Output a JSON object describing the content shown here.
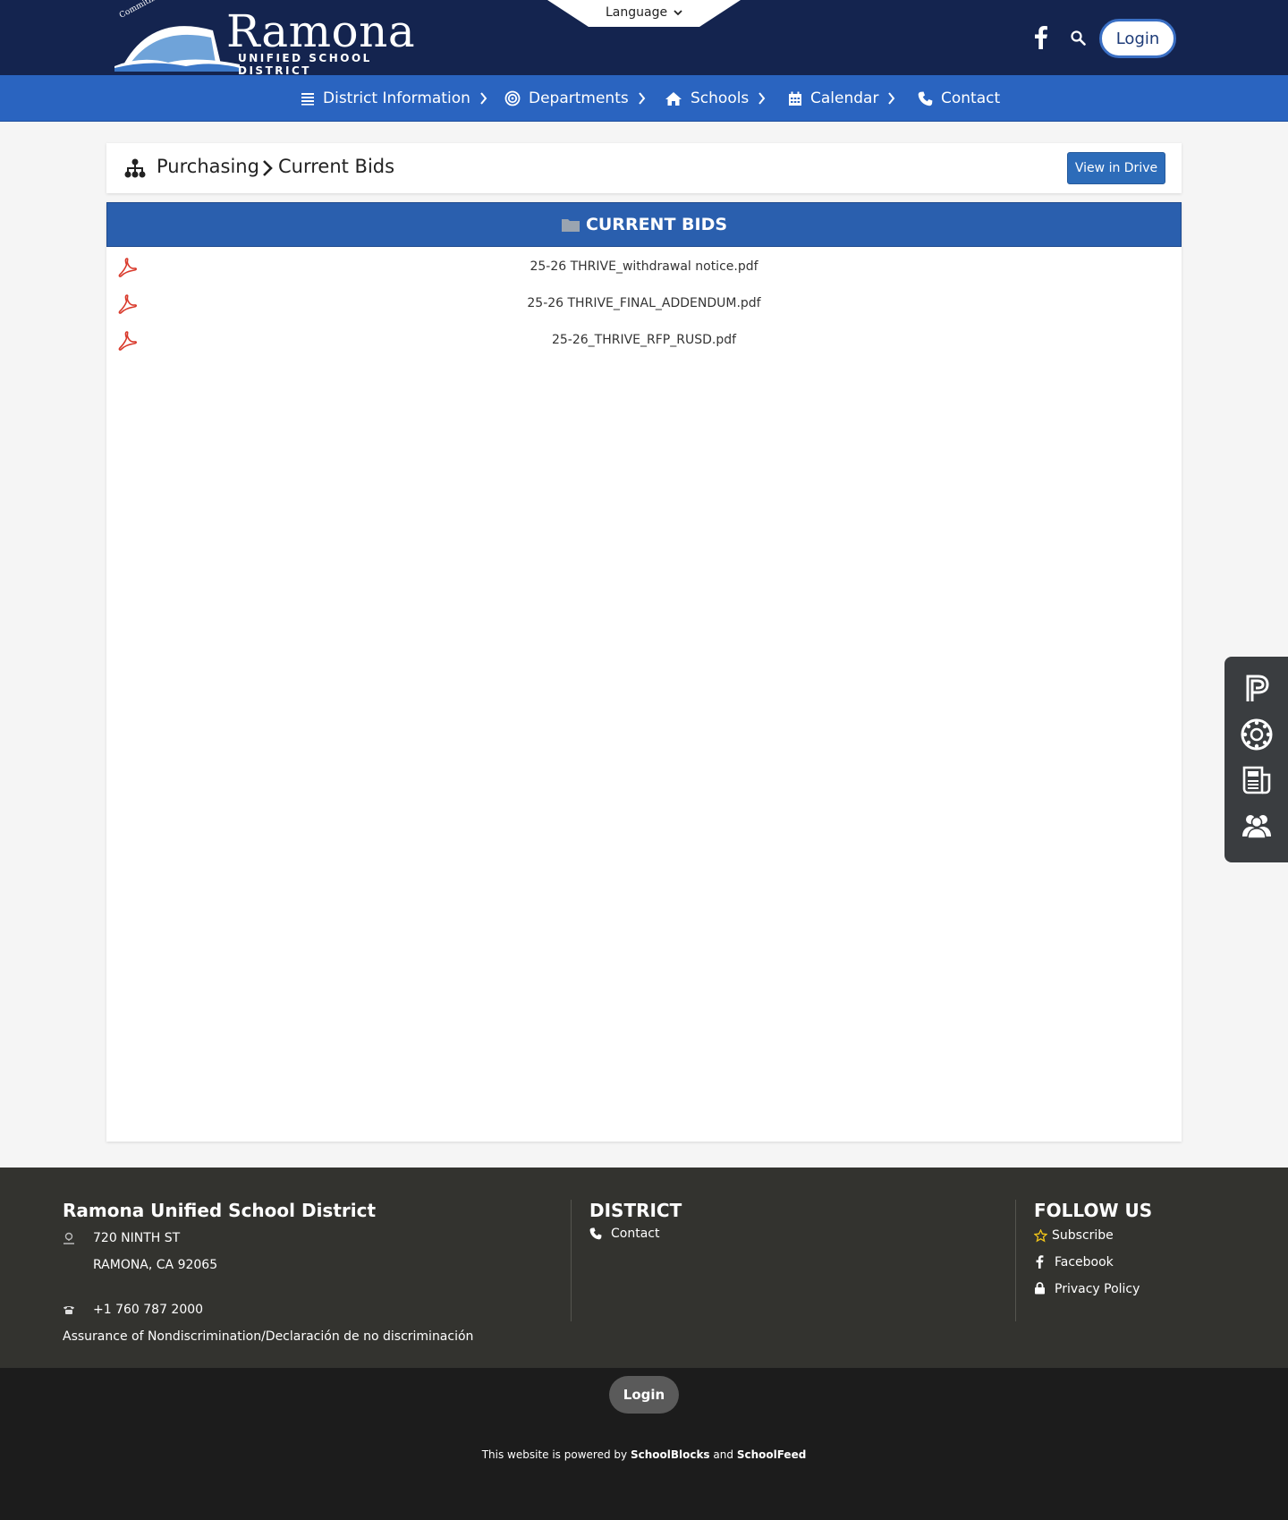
{
  "header": {
    "logo_title": "Ramona",
    "logo_subtitle": "UNIFIED SCHOOL DISTRICT",
    "logo_motto": "Commitment to Excellence",
    "language_label": "Language",
    "login_label": "Login"
  },
  "nav": {
    "items": [
      {
        "label": "District Information",
        "icon": "list-icon",
        "has_submenu": true
      },
      {
        "label": "Departments",
        "icon": "target-icon",
        "has_submenu": true
      },
      {
        "label": "Schools",
        "icon": "home-icon",
        "has_submenu": true
      },
      {
        "label": "Calendar",
        "icon": "calendar-icon",
        "has_submenu": true
      },
      {
        "label": "Contact",
        "icon": "phone-icon",
        "has_submenu": false
      }
    ]
  },
  "breadcrumb": {
    "items": [
      "Purchasing",
      "Current Bids"
    ],
    "view_in_drive_label": "View in Drive"
  },
  "panel": {
    "title": "CURRENT BIDS",
    "files": [
      {
        "name": "25-26 THRIVE_withdrawal notice.pdf",
        "icon": "pdf-icon"
      },
      {
        "name": "25-26 THRIVE_FINAL_ADDENDUM.pdf",
        "icon": "pdf-icon"
      },
      {
        "name": "25-26_THRIVE_RFP_RUSD.pdf",
        "icon": "pdf-icon"
      }
    ]
  },
  "side_links": [
    "powerschool-icon",
    "canvas-icon",
    "news-icon",
    "community-icon"
  ],
  "footer": {
    "org_name": "Ramona Unified School District",
    "address_line1": "720 NINTH ST",
    "address_line2": "RAMONA, CA 92065",
    "phone": "+1 760 787 2000",
    "nondiscrimination": "Assurance of Nondiscrimination/Declaración de no discriminación",
    "district_title": "DISTRICT",
    "district_links": [
      "Contact"
    ],
    "follow_title": "FOLLOW US",
    "follow_links": [
      "Subscribe",
      "Facebook",
      "Privacy Policy"
    ]
  },
  "bottom": {
    "login_label": "Login",
    "powered_prefix": "This website is powered by",
    "powered_brand1": "SchoolBlocks",
    "powered_and": "and",
    "powered_brand2": "SchoolFeed"
  },
  "colors": {
    "header_bg": "#14244f",
    "nav_bg": "#2a64c0",
    "panel_head_bg": "#2a5fae",
    "pdf_red": "#d9392b",
    "footer_bg": "#33332f",
    "bottom_bg": "#1c1c1c"
  }
}
